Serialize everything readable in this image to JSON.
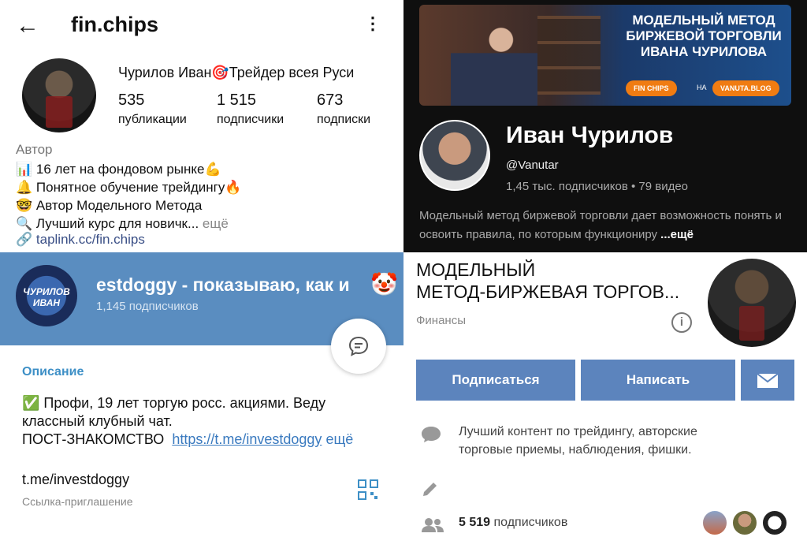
{
  "instagram": {
    "back_icon": "arrow-left-icon",
    "username": "fin.chips",
    "menu_icon": "more-vertical-icon",
    "full_name": "Чурилов Иван🎯Трейдер всея Руси",
    "stats": [
      {
        "num": "535",
        "label": "публикации"
      },
      {
        "num": "1 515",
        "label": "подписчики"
      },
      {
        "num": "673",
        "label": "подписки"
      }
    ],
    "category": "Автор",
    "bio": [
      "📊 16 лет на фондовом рынке💪",
      "🔔 Понятное обучение трейдингу🔥",
      "🤓 Автор Модельного Метода",
      "🔍 Лучший курс для новичк..."
    ],
    "bio_more": "ещё",
    "link": "🔗 taplink.cc/fin.chips"
  },
  "youtube": {
    "banner_title": "МОДЕЛЬНЫЙ МЕТОД БИРЖЕВОЙ ТОРГОВЛИ ИВАНА ЧУРИЛОВА",
    "banner_pill1": "FIN CHIPS",
    "banner_na": "НА",
    "banner_pill2": "VANUTA.BLOG",
    "channel_name": "Иван Чурилов",
    "handle": "@Vanutar",
    "meta": "1,45 тыс. подписчиков • 79 видео",
    "description": "Модельный метод биржевой торговли дает возможность понять и освоить правила, по которым функциониру",
    "more": "...ещё"
  },
  "telegram": {
    "avatar_text": "ЧУРИЛОВ ИВАН",
    "channel_title": "estdoggy - показываю, как и",
    "title_emoji": "🤡",
    "subscribers": "1,145 подписчиков",
    "fab_icon": "chat-bubble-icon",
    "section_label": "Описание",
    "about_line1": "✅ Профи, 19 лет торгую росс. акциями. Веду",
    "about_line2": "классный клубный чат.",
    "about_line3_prefix": "ПОСТ-ЗНАКОМСТВО",
    "about_url": "https://t.me/investdoggy",
    "about_more": "ещё",
    "invite_link": "t.me/investdoggy",
    "invite_label": "Ссылка-приглашение",
    "qr_icon": "qr-code-icon"
  },
  "vk": {
    "title_line1": "МОДЕЛЬНЫЙ",
    "title_line2": "МЕТОД-БИРЖЕВАЯ ТОРГОВ...",
    "category": "Финансы",
    "info_icon": "info-icon",
    "subscribe_label": "Подписаться",
    "message_label": "Написать",
    "mail_icon": "envelope-icon",
    "about_text": "Лучший контент по трейдингу, авторские торговые приемы, наблюдения, фишки.",
    "subs_count": "5 519",
    "subs_label": "подписчиков",
    "colors": {
      "button": "#5c84bd",
      "tg_header": "#5a8dc0",
      "yt_bg": "#0f0f0f"
    }
  }
}
